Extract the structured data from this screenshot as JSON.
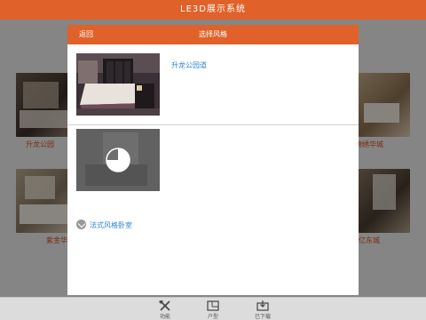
{
  "app": {
    "title": "LE3D展示系统"
  },
  "background_projects": [
    {
      "label": "升龙公园"
    },
    {
      "label": "锦绣华城"
    },
    {
      "label": "紫金华"
    },
    {
      "label": "亿东城"
    }
  ],
  "modal": {
    "back_label": "返回",
    "title": "选择风格",
    "styles": [
      {
        "name": "升龙公园道",
        "status": "downloaded"
      },
      {
        "name": "法式风格卧室",
        "status": "downloading",
        "progress": 0.75
      }
    ]
  },
  "bottom_tabs": [
    {
      "label": "功能",
      "icon": "tools-icon"
    },
    {
      "label": "户型",
      "icon": "floorplan-icon"
    },
    {
      "label": "已下载",
      "icon": "download-box-icon"
    }
  ],
  "colors": {
    "accent": "#e0622a",
    "link": "#2f86d6"
  }
}
